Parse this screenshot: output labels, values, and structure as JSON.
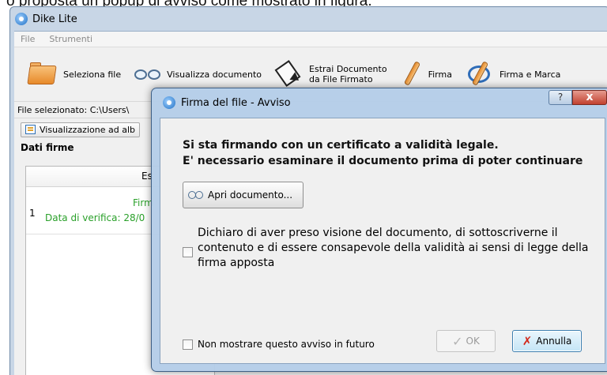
{
  "caption": "o proposta un popup di avviso come mostrato in figura.",
  "window": {
    "title": "Dike Lite"
  },
  "menu": {
    "items": [
      "File",
      "Strumenti"
    ]
  },
  "toolbar": {
    "seleziona_file": "Seleziona file",
    "visualizza_documento": "Visualizza documento",
    "estrai_line1": "Estrai Documento",
    "estrai_line2": "da File Firmato",
    "firma": "Firma",
    "firma_marca": "Firma e Marca"
  },
  "file_bar": {
    "text": "File selezionato: C:\\Users\\"
  },
  "view_button": {
    "label": "Visualizzazione ad alb"
  },
  "section": {
    "title": "Dati firme"
  },
  "grid": {
    "header": "Es",
    "row": {
      "number": "1",
      "line1": "Firm",
      "line2": "Data di verifica: 28/0"
    }
  },
  "dialog": {
    "title": "Firma del file - Avviso",
    "help_glyph": "?",
    "close_glyph": "x",
    "headline_1": "Si sta firmando con un certificato a validità legale.",
    "headline_2": "E' necessario esaminare il documento prima di poter continuare",
    "open_button": "Apri documento...",
    "declaration": "Dichiaro di aver preso visione del documento, di sottoscriverne il contenuto e di essere consapevole della validità ai sensi di legge della firma apposta",
    "no_show": "Non mostrare questo avviso in futuro",
    "ok": "OK",
    "cancel": "Annulla"
  }
}
